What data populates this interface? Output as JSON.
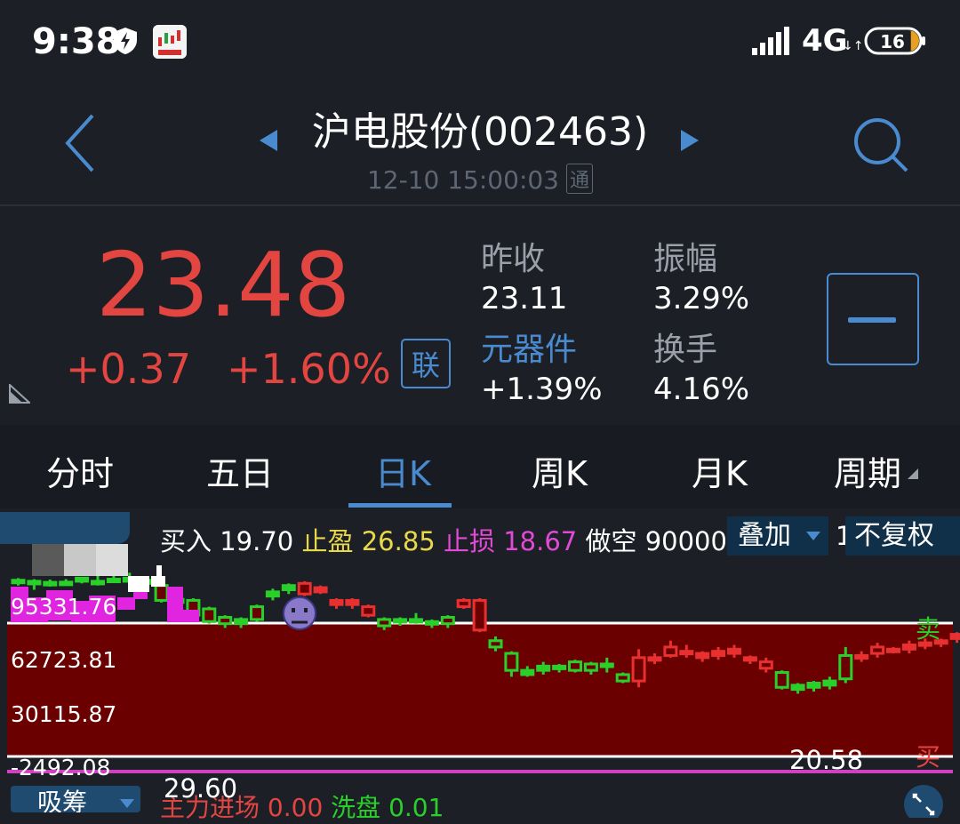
{
  "status_bar": {
    "time": "9:38",
    "network": "4G",
    "network_arrows": "↓↑",
    "signal_bars": 5,
    "battery_level": "16",
    "battery_fraction": 0.16
  },
  "header": {
    "title": "沪电股份(002463)",
    "timestamp": "12-10 15:00:03",
    "channel_badge": "通"
  },
  "quote": {
    "price": "23.48",
    "change_abs": "+0.37",
    "change_pct": "+1.60%",
    "lian_label": "联",
    "prev_close_label": "昨收",
    "prev_close_value": "23.11",
    "amplitude_label": "振幅",
    "amplitude_value": "3.29%",
    "sector_label": "元器件",
    "sector_value": "+1.39%",
    "turnover_label": "换手",
    "turnover_value": "4.16%"
  },
  "tabs": [
    {
      "label": "分时"
    },
    {
      "label": "五日"
    },
    {
      "label": "日K"
    },
    {
      "label": "周K"
    },
    {
      "label": "月K"
    },
    {
      "label": "周期"
    }
  ],
  "chart_info": {
    "buy_label": "买入",
    "buy_value": "19.70",
    "take_profit_label": "止盈",
    "take_profit_value": "26.85",
    "stop_loss_label": "止损",
    "stop_loss_value": "18.67",
    "short_label": "做空",
    "short_value": "90000",
    "overlay_button": "叠加",
    "cut_digit": "1",
    "adjust_button": "不复权"
  },
  "chart_labels": {
    "y_axis": [
      "95331.76",
      "62723.81",
      "30115.87",
      "-2492.08"
    ],
    "sell_marker": "卖",
    "buy_marker": "买",
    "low_marker": "20.58"
  },
  "bottom_indicator": {
    "button_label": "吸筹",
    "value": "29.60",
    "main_inflow_label": "主力进场",
    "main_inflow_value": "0.00",
    "wash_label": "洗盘",
    "wash_value": "0.01"
  },
  "colors": {
    "background": "#1c1f26",
    "up": "#e34541",
    "down": "#2ad02a",
    "accent": "#4a8bd0",
    "band": "#6b0000",
    "magenta": "#e024e0"
  },
  "chart_data": {
    "type": "candlestick",
    "ylim": [
      18.5,
      27.3
    ],
    "candles": [
      {
        "o": 26.85,
        "c": 26.78,
        "h": 26.95,
        "l": 26.6,
        "up": false
      },
      {
        "o": 26.8,
        "c": 26.7,
        "h": 26.9,
        "l": 26.4,
        "up": false
      },
      {
        "o": 26.75,
        "c": 26.72,
        "h": 26.88,
        "l": 26.55,
        "up": false
      },
      {
        "o": 26.76,
        "c": 26.7,
        "h": 26.9,
        "l": 26.6,
        "up": false
      },
      {
        "o": 26.95,
        "c": 26.8,
        "h": 27.0,
        "l": 26.7,
        "up": false
      },
      {
        "o": 26.8,
        "c": 26.7,
        "h": 27.1,
        "l": 26.6,
        "up": false
      },
      {
        "o": 26.9,
        "c": 26.85,
        "h": 27.05,
        "l": 26.75,
        "up": false
      },
      {
        "o": 26.95,
        "c": 26.8,
        "h": 27.2,
        "l": 26.7,
        "up": false
      },
      {
        "o": 26.85,
        "c": 26.7,
        "h": 27.0,
        "l": 26.6,
        "up": false
      },
      {
        "o": 26.6,
        "c": 25.9,
        "h": 26.65,
        "l": 25.8,
        "up": false
      },
      {
        "o": 25.95,
        "c": 25.8,
        "h": 26.05,
        "l": 25.7,
        "up": false
      },
      {
        "o": 25.9,
        "c": 25.2,
        "h": 26.0,
        "l": 25.1,
        "up": false
      },
      {
        "o": 25.5,
        "c": 24.9,
        "h": 25.6,
        "l": 24.8,
        "up": false
      },
      {
        "o": 25.1,
        "c": 24.8,
        "h": 25.2,
        "l": 24.6,
        "up": false
      },
      {
        "o": 25.0,
        "c": 24.8,
        "h": 25.1,
        "l": 24.6,
        "up": false
      },
      {
        "o": 25.6,
        "c": 25.0,
        "h": 25.7,
        "l": 24.9,
        "up": false
      },
      {
        "o": 26.1,
        "c": 26.3,
        "h": 26.45,
        "l": 25.9,
        "up": false
      },
      {
        "o": 26.4,
        "c": 26.6,
        "h": 26.7,
        "l": 26.2,
        "up": false
      },
      {
        "o": 26.7,
        "c": 26.2,
        "h": 26.8,
        "l": 26.1,
        "up": true
      },
      {
        "o": 26.5,
        "c": 26.3,
        "h": 26.6,
        "l": 26.2,
        "up": true
      },
      {
        "o": 25.9,
        "c": 25.7,
        "h": 26.0,
        "l": 25.5,
        "up": true
      },
      {
        "o": 25.9,
        "c": 25.7,
        "h": 26.0,
        "l": 25.5,
        "up": true
      },
      {
        "o": 25.6,
        "c": 25.2,
        "h": 25.7,
        "l": 25.1,
        "up": true
      },
      {
        "o": 25.0,
        "c": 24.7,
        "h": 25.1,
        "l": 24.5,
        "up": false
      },
      {
        "o": 25.0,
        "c": 24.9,
        "h": 25.1,
        "l": 24.7,
        "up": false
      },
      {
        "o": 25.0,
        "c": 24.9,
        "h": 25.3,
        "l": 24.8,
        "up": false
      },
      {
        "o": 24.9,
        "c": 24.8,
        "h": 25.0,
        "l": 24.6,
        "up": false
      },
      {
        "o": 25.1,
        "c": 24.8,
        "h": 25.2,
        "l": 24.6,
        "up": false
      },
      {
        "o": 25.6,
        "c": 25.9,
        "h": 26.0,
        "l": 25.5,
        "up": true
      },
      {
        "o": 25.9,
        "c": 24.5,
        "h": 26.0,
        "l": 24.4,
        "up": true
      },
      {
        "o": 23.7,
        "c": 24.0,
        "h": 24.2,
        "l": 23.5,
        "up": false
      },
      {
        "o": 22.6,
        "c": 23.4,
        "h": 23.5,
        "l": 22.3,
        "up": false
      },
      {
        "o": 22.6,
        "c": 22.4,
        "h": 22.8,
        "l": 22.3,
        "up": false
      },
      {
        "o": 22.8,
        "c": 22.6,
        "h": 23.0,
        "l": 22.4,
        "up": false
      },
      {
        "o": 22.8,
        "c": 22.7,
        "h": 22.9,
        "l": 22.5,
        "up": false
      },
      {
        "o": 23.0,
        "c": 22.6,
        "h": 23.1,
        "l": 22.5,
        "up": false
      },
      {
        "o": 22.9,
        "c": 22.6,
        "h": 23.0,
        "l": 22.4,
        "up": false
      },
      {
        "o": 22.9,
        "c": 22.8,
        "h": 23.2,
        "l": 22.5,
        "up": false
      },
      {
        "o": 22.4,
        "c": 22.1,
        "h": 22.5,
        "l": 22.0,
        "up": false
      },
      {
        "o": 22.1,
        "c": 23.2,
        "h": 23.6,
        "l": 21.8,
        "up": true
      },
      {
        "o": 23.1,
        "c": 23.2,
        "h": 23.4,
        "l": 22.9,
        "up": true
      },
      {
        "o": 23.3,
        "c": 23.7,
        "h": 24.0,
        "l": 23.2,
        "up": true
      },
      {
        "o": 23.5,
        "c": 23.4,
        "h": 23.8,
        "l": 23.2,
        "up": true
      },
      {
        "o": 23.2,
        "c": 23.4,
        "h": 23.5,
        "l": 23.0,
        "up": true
      },
      {
        "o": 23.3,
        "c": 23.5,
        "h": 23.7,
        "l": 23.1,
        "up": true
      },
      {
        "o": 23.4,
        "c": 23.6,
        "h": 23.8,
        "l": 23.2,
        "up": true
      },
      {
        "o": 23.2,
        "c": 23.1,
        "h": 23.3,
        "l": 22.9,
        "up": true
      },
      {
        "o": 23.0,
        "c": 22.7,
        "h": 23.2,
        "l": 22.5,
        "up": true
      },
      {
        "o": 22.5,
        "c": 21.8,
        "h": 22.6,
        "l": 21.7,
        "up": false
      },
      {
        "o": 21.9,
        "c": 21.7,
        "h": 22.0,
        "l": 21.5,
        "up": false
      },
      {
        "o": 22.0,
        "c": 21.8,
        "h": 22.1,
        "l": 21.6,
        "up": false
      },
      {
        "o": 22.1,
        "c": 21.9,
        "h": 22.3,
        "l": 21.7,
        "up": false
      },
      {
        "o": 22.2,
        "c": 23.3,
        "h": 23.7,
        "l": 22.0,
        "up": false
      },
      {
        "o": 23.3,
        "c": 23.2,
        "h": 23.5,
        "l": 23.0,
        "up": true
      },
      {
        "o": 23.4,
        "c": 23.7,
        "h": 23.9,
        "l": 23.2,
        "up": true
      },
      {
        "o": 23.5,
        "c": 23.6,
        "h": 23.7,
        "l": 23.4,
        "up": true
      },
      {
        "o": 23.6,
        "c": 23.8,
        "h": 24.0,
        "l": 23.4,
        "up": true
      },
      {
        "o": 23.8,
        "c": 23.9,
        "h": 24.1,
        "l": 23.6,
        "up": true
      },
      {
        "o": 23.9,
        "c": 24.0,
        "h": 24.1,
        "l": 23.7,
        "up": true
      },
      {
        "o": 24.1,
        "c": 24.3,
        "h": 24.4,
        "l": 23.9,
        "up": true
      }
    ]
  }
}
